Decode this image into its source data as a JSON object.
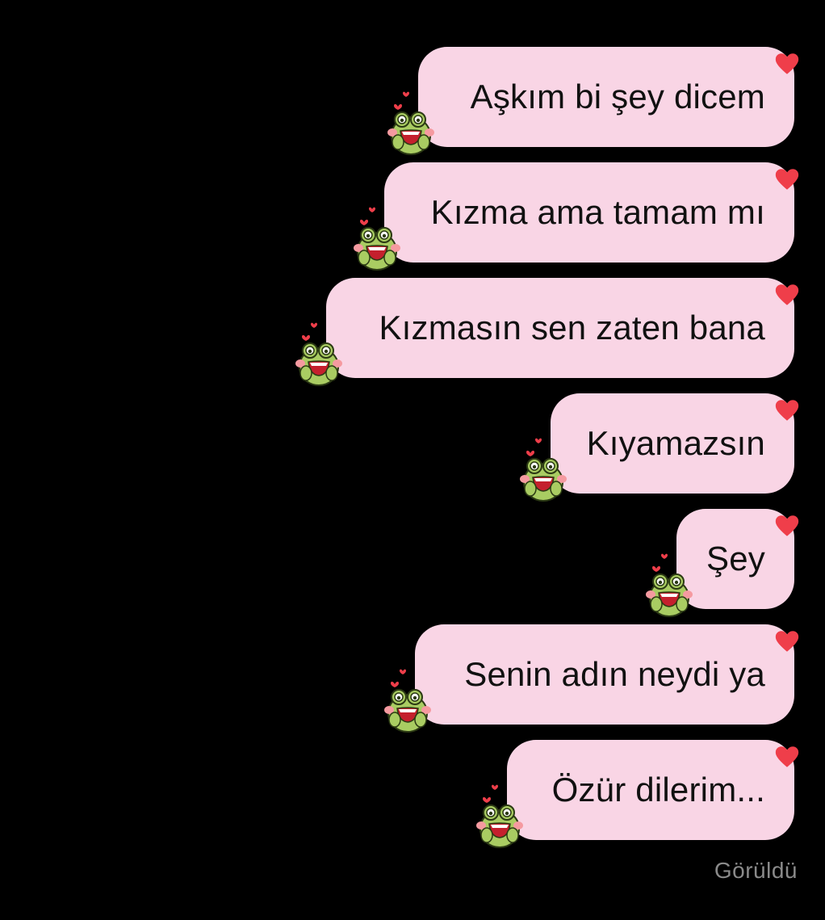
{
  "messages": [
    {
      "text": "Aşkım bi şey dicem"
    },
    {
      "text": "Kızma ama tamam mı"
    },
    {
      "text": "Kızmasın sen zaten bana"
    },
    {
      "text": "Kıyamazsın"
    },
    {
      "text": "Şey"
    },
    {
      "text": "Senin adın neydi ya"
    },
    {
      "text": "Özür dilerim..."
    }
  ],
  "status": {
    "seen_label": "Görüldü"
  },
  "colors": {
    "background": "#000000",
    "bubble": "#f9d5e5",
    "heart": "#ef3e4a",
    "frog": "#9bc45a"
  },
  "icons": {
    "reaction": "heart-icon",
    "sticker": "frog-sticker-icon"
  }
}
